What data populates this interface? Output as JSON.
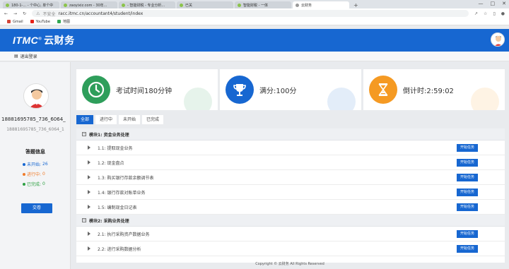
{
  "browser": {
    "tabs": [
      {
        "label": "180-1-... - 个中心, 单个中"
      },
      {
        "label": "zaoyixiz.com - 30年..."
      },
      {
        "label": "- 智能财税 - 专业分析..."
      },
      {
        "label": "已关"
      },
      {
        "label": "智能财税 - 一体"
      },
      {
        "label": "云财务"
      }
    ],
    "new_tab": "+",
    "url_security": "不安全",
    "url": "racc.itmc.cn/accountant4/student/index",
    "bookmarks": [
      "Gmail",
      "YouTube",
      "地图"
    ]
  },
  "header": {
    "logo_text": "ITMC",
    "logo_reg": "®",
    "logo_cn": "云财务"
  },
  "subbar": {
    "label": "退出登录"
  },
  "sidebar": {
    "username": "18881695785_736_6064_",
    "user_id": "18881695785_736_6064_1",
    "answer_title": "答题信息",
    "stats": [
      {
        "label": "未开始:",
        "value": "26",
        "color": "#1767d1"
      },
      {
        "label": "进行中:",
        "value": "0",
        "color": "#f07c2a"
      },
      {
        "label": "已完成:",
        "value": "0",
        "color": "#2ea043"
      }
    ],
    "submit_label": "交卷"
  },
  "cards": [
    {
      "text": "考试时间180分钟",
      "color": "#2e9e5b",
      "icon": "clock-icon"
    },
    {
      "text": "满分:100分",
      "color": "#1767d1",
      "icon": "trophy-icon"
    },
    {
      "text": "倒计时:2:59:02",
      "color": "#f59a23",
      "icon": "hourglass-icon"
    }
  ],
  "filters": [
    {
      "label": "全部",
      "active": true
    },
    {
      "label": "进行中",
      "active": false
    },
    {
      "label": "未开始",
      "active": false
    },
    {
      "label": "已完成",
      "active": false
    }
  ],
  "modules": [
    {
      "title": "模块1: 资金业务处理",
      "tasks": [
        {
          "label": "1.1: 提取现金业务",
          "action": "开始任务"
        },
        {
          "label": "1.2: 现金盘点",
          "action": "开始任务"
        },
        {
          "label": "1.3: 购买银行存款余额调节表",
          "action": "开始任务"
        },
        {
          "label": "1.4: 银行存款对账单业务",
          "action": "开始任务"
        },
        {
          "label": "1.5: 编制现金日记表",
          "action": "开始任务"
        }
      ]
    },
    {
      "title": "模块2: 采购业务处理",
      "tasks": [
        {
          "label": "2.1: 执行采购资产数据业务",
          "action": "开始任务"
        },
        {
          "label": "2.2: 进行采购数据分析",
          "action": "开始任务"
        }
      ]
    }
  ],
  "footer": "Copyright © 云财务 All Rights Reserved"
}
